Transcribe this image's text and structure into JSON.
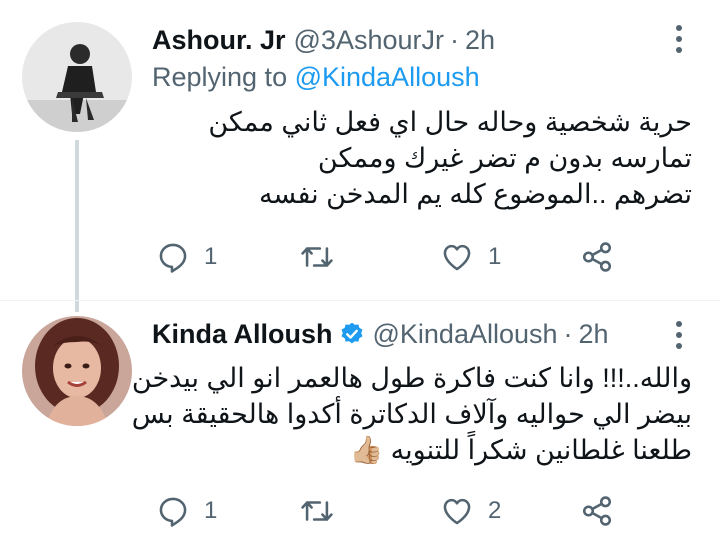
{
  "tweets": [
    {
      "name": "Ashour. Jr",
      "handle": "@3AshourJr",
      "dot": "·",
      "time": "2h",
      "reply_prefix": "Replying to ",
      "reply_mention": "@KindaAlloush",
      "text_lines": [
        "حرية شخصية وحاله حال اي فعل ثاني ممكن",
        "تمارسه بدون م تضر غيرك وممكن",
        "تضرهم ..الموضوع كله يم المدخن نفسه"
      ],
      "replies": "1",
      "retweets": "",
      "likes": "1",
      "verified": false
    },
    {
      "name": "Kinda Alloush",
      "handle": "@KindaAlloush",
      "dot": "·",
      "time": "2h",
      "text_lines": [
        "والله..!!! وانا كنت فاكرة طول هالعمر انو الي بيدخن",
        "بيضر الي حواليه وآلاف الدكاترة أكدوا هالحقيقة بس",
        "طلعنا غلطانين شكراً للتنويه 👍🏼"
      ],
      "replies": "1",
      "retweets": "",
      "likes": "2",
      "verified": true
    }
  ],
  "colors": {
    "text": "#0f1419",
    "secondary": "#536471",
    "accent": "#1d9bf0",
    "thread_line": "#cfd9de"
  }
}
